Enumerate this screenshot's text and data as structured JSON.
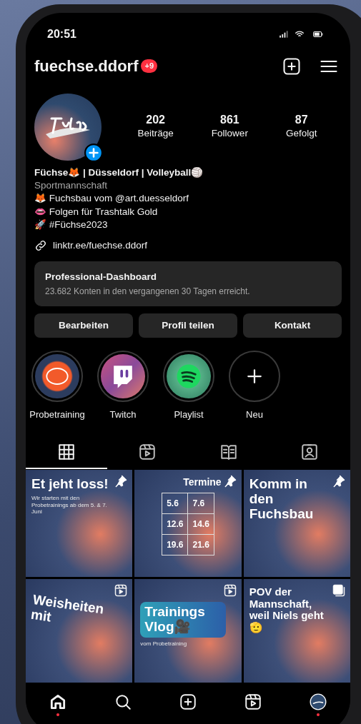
{
  "status_bar": {
    "time": "20:51"
  },
  "header": {
    "username": "fuechse.ddorf",
    "badge": "+9"
  },
  "profile": {
    "stats": [
      {
        "value": "202",
        "label": "Beiträge"
      },
      {
        "value": "861",
        "label": "Follower"
      },
      {
        "value": "87",
        "label": "Gefolgt"
      }
    ],
    "name": "Füchse🦊 | Düsseldorf | Volleyball🏐",
    "category": "Sportmannschaft",
    "bio_lines": [
      "🦊 Fuchsbau vom @art.duesseldorf",
      "👄 Folgen für Trashtalk Gold",
      "🚀 #Füchse2023"
    ],
    "link": "linktr.ee/fuechse.ddorf"
  },
  "dashboard": {
    "title": "Professional-Dashboard",
    "subtitle": "23.682 Konten in den vergangenen 30 Tagen erreicht."
  },
  "buttons": [
    "Bearbeiten",
    "Profil teilen",
    "Kontakt"
  ],
  "highlights": [
    {
      "label": "Probetraining",
      "kind": "fuchse"
    },
    {
      "label": "Twitch",
      "kind": "twitch"
    },
    {
      "label": "Playlist",
      "kind": "spotify"
    },
    {
      "label": "Neu",
      "kind": "new"
    }
  ],
  "tabs": [
    {
      "kind": "grid",
      "selected": true
    },
    {
      "kind": "reels",
      "selected": false
    },
    {
      "kind": "guides",
      "selected": false
    },
    {
      "kind": "tagged",
      "selected": false
    }
  ],
  "posts": [
    {
      "kind": "pinned",
      "headline": "Et jeht loss!",
      "text": "Wir starten mit den Probetrainings ab dem 5. & 7. Juni"
    },
    {
      "kind": "pinned",
      "headline": "Termine",
      "dates": [
        "5.6",
        "7.6",
        "12.6",
        "14.6",
        "19.6",
        "21.6"
      ]
    },
    {
      "kind": "pinned",
      "headline": "Komm in den Fuchsbau"
    },
    {
      "kind": "reel",
      "headline": "Weisheiten mit"
    },
    {
      "kind": "reel",
      "headline": "Trainings Vlog🎥",
      "text": "vom Probetraining"
    },
    {
      "kind": "carousel",
      "headline": "POV der Mannschaft, weil Niels geht🫡"
    }
  ],
  "bottom_nav": [
    {
      "kind": "home",
      "selected": true,
      "dot": true
    },
    {
      "kind": "search",
      "selected": false,
      "dot": false
    },
    {
      "kind": "create",
      "selected": false,
      "dot": false
    },
    {
      "kind": "reels",
      "selected": false,
      "dot": false
    },
    {
      "kind": "profile",
      "selected": false,
      "dot": true
    }
  ]
}
